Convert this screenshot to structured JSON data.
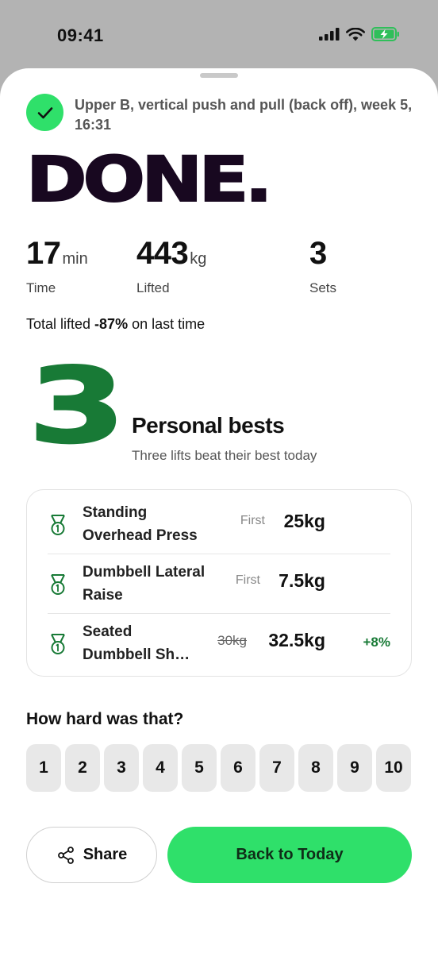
{
  "status_bar": {
    "time": "09:41"
  },
  "workout": {
    "title": "Upper B, vertical push and pull (back off), week 5, 16:31"
  },
  "headline": "DONE.",
  "stats": [
    {
      "value": "17",
      "unit": "min",
      "label": "Time"
    },
    {
      "value": "443",
      "unit": "kg",
      "label": "Lifted"
    },
    {
      "value": "3",
      "unit": "",
      "label": "Sets"
    }
  ],
  "total_lifted": {
    "prefix": "Total lifted ",
    "change": "-87%",
    "suffix": " on last time"
  },
  "personal_bests": {
    "count": "3",
    "heading": "Personal bests",
    "subtitle": "Three lifts beat their best today",
    "items": [
      {
        "name_line1": "Standing",
        "name_line2": "Overhead Press",
        "previous": "First",
        "weight": "25kg",
        "delta": ""
      },
      {
        "name_line1": "Dumbbell Lateral",
        "name_line2": "Raise",
        "previous": "First",
        "weight": "7.5kg",
        "delta": ""
      },
      {
        "name_line1": "Seated",
        "name_line2": "Dumbbell Sh…",
        "previous": "30kg",
        "weight": "32.5kg",
        "delta": "+8%"
      }
    ]
  },
  "rpe": {
    "title": "How hard was that?",
    "options": [
      "1",
      "2",
      "3",
      "4",
      "5",
      "6",
      "7",
      "8",
      "9",
      "10"
    ]
  },
  "actions": {
    "share_label": "Share",
    "primary_label": "Back to Today"
  },
  "icons": {
    "check": "check-icon",
    "medal": "medal-icon",
    "share": "share-icon",
    "signal": "signal-icon",
    "wifi": "wifi-icon",
    "battery": "battery-charging-icon"
  },
  "colors": {
    "accent_green": "#2fe06a",
    "dark_green": "#187a36",
    "headline": "#180820"
  }
}
